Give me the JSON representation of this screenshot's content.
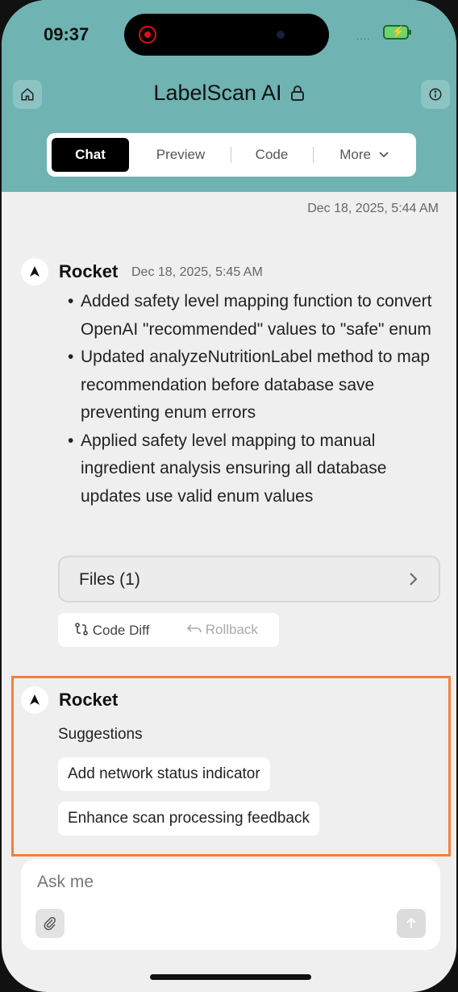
{
  "status": {
    "time": "09:37",
    "signal": "...."
  },
  "header": {
    "title": "LabelScan AI",
    "tabs": [
      {
        "label": "Chat",
        "active": true
      },
      {
        "label": "Preview"
      },
      {
        "label": "Code"
      },
      {
        "label": "More"
      }
    ]
  },
  "chat": {
    "user_timestamp": "Dec 18, 2025, 5:44 AM",
    "message1": {
      "author": "Rocket",
      "time": "Dec 18, 2025, 5:45 AM",
      "bullets": [
        "Added safety level mapping function to convert OpenAI \"recommended\" values to \"safe\" enum",
        "Updated analyzeNutritionLabel method to map recommendation before database save preventing enum errors",
        "Applied safety level mapping to manual ingredient analysis ensuring all database updates use valid enum values"
      ],
      "files_label": "Files (1)",
      "code_diff": "Code Diff",
      "rollback": "Rollback"
    },
    "message2": {
      "author": "Rocket",
      "suggestions_title": "Suggestions",
      "suggestions": [
        "Add network status indicator",
        "Enhance scan processing feedback"
      ]
    }
  },
  "input": {
    "placeholder": "Ask me"
  },
  "colors": {
    "header": "#6fb3b3",
    "highlight": "#f0803c",
    "active_tab": "#000000"
  }
}
